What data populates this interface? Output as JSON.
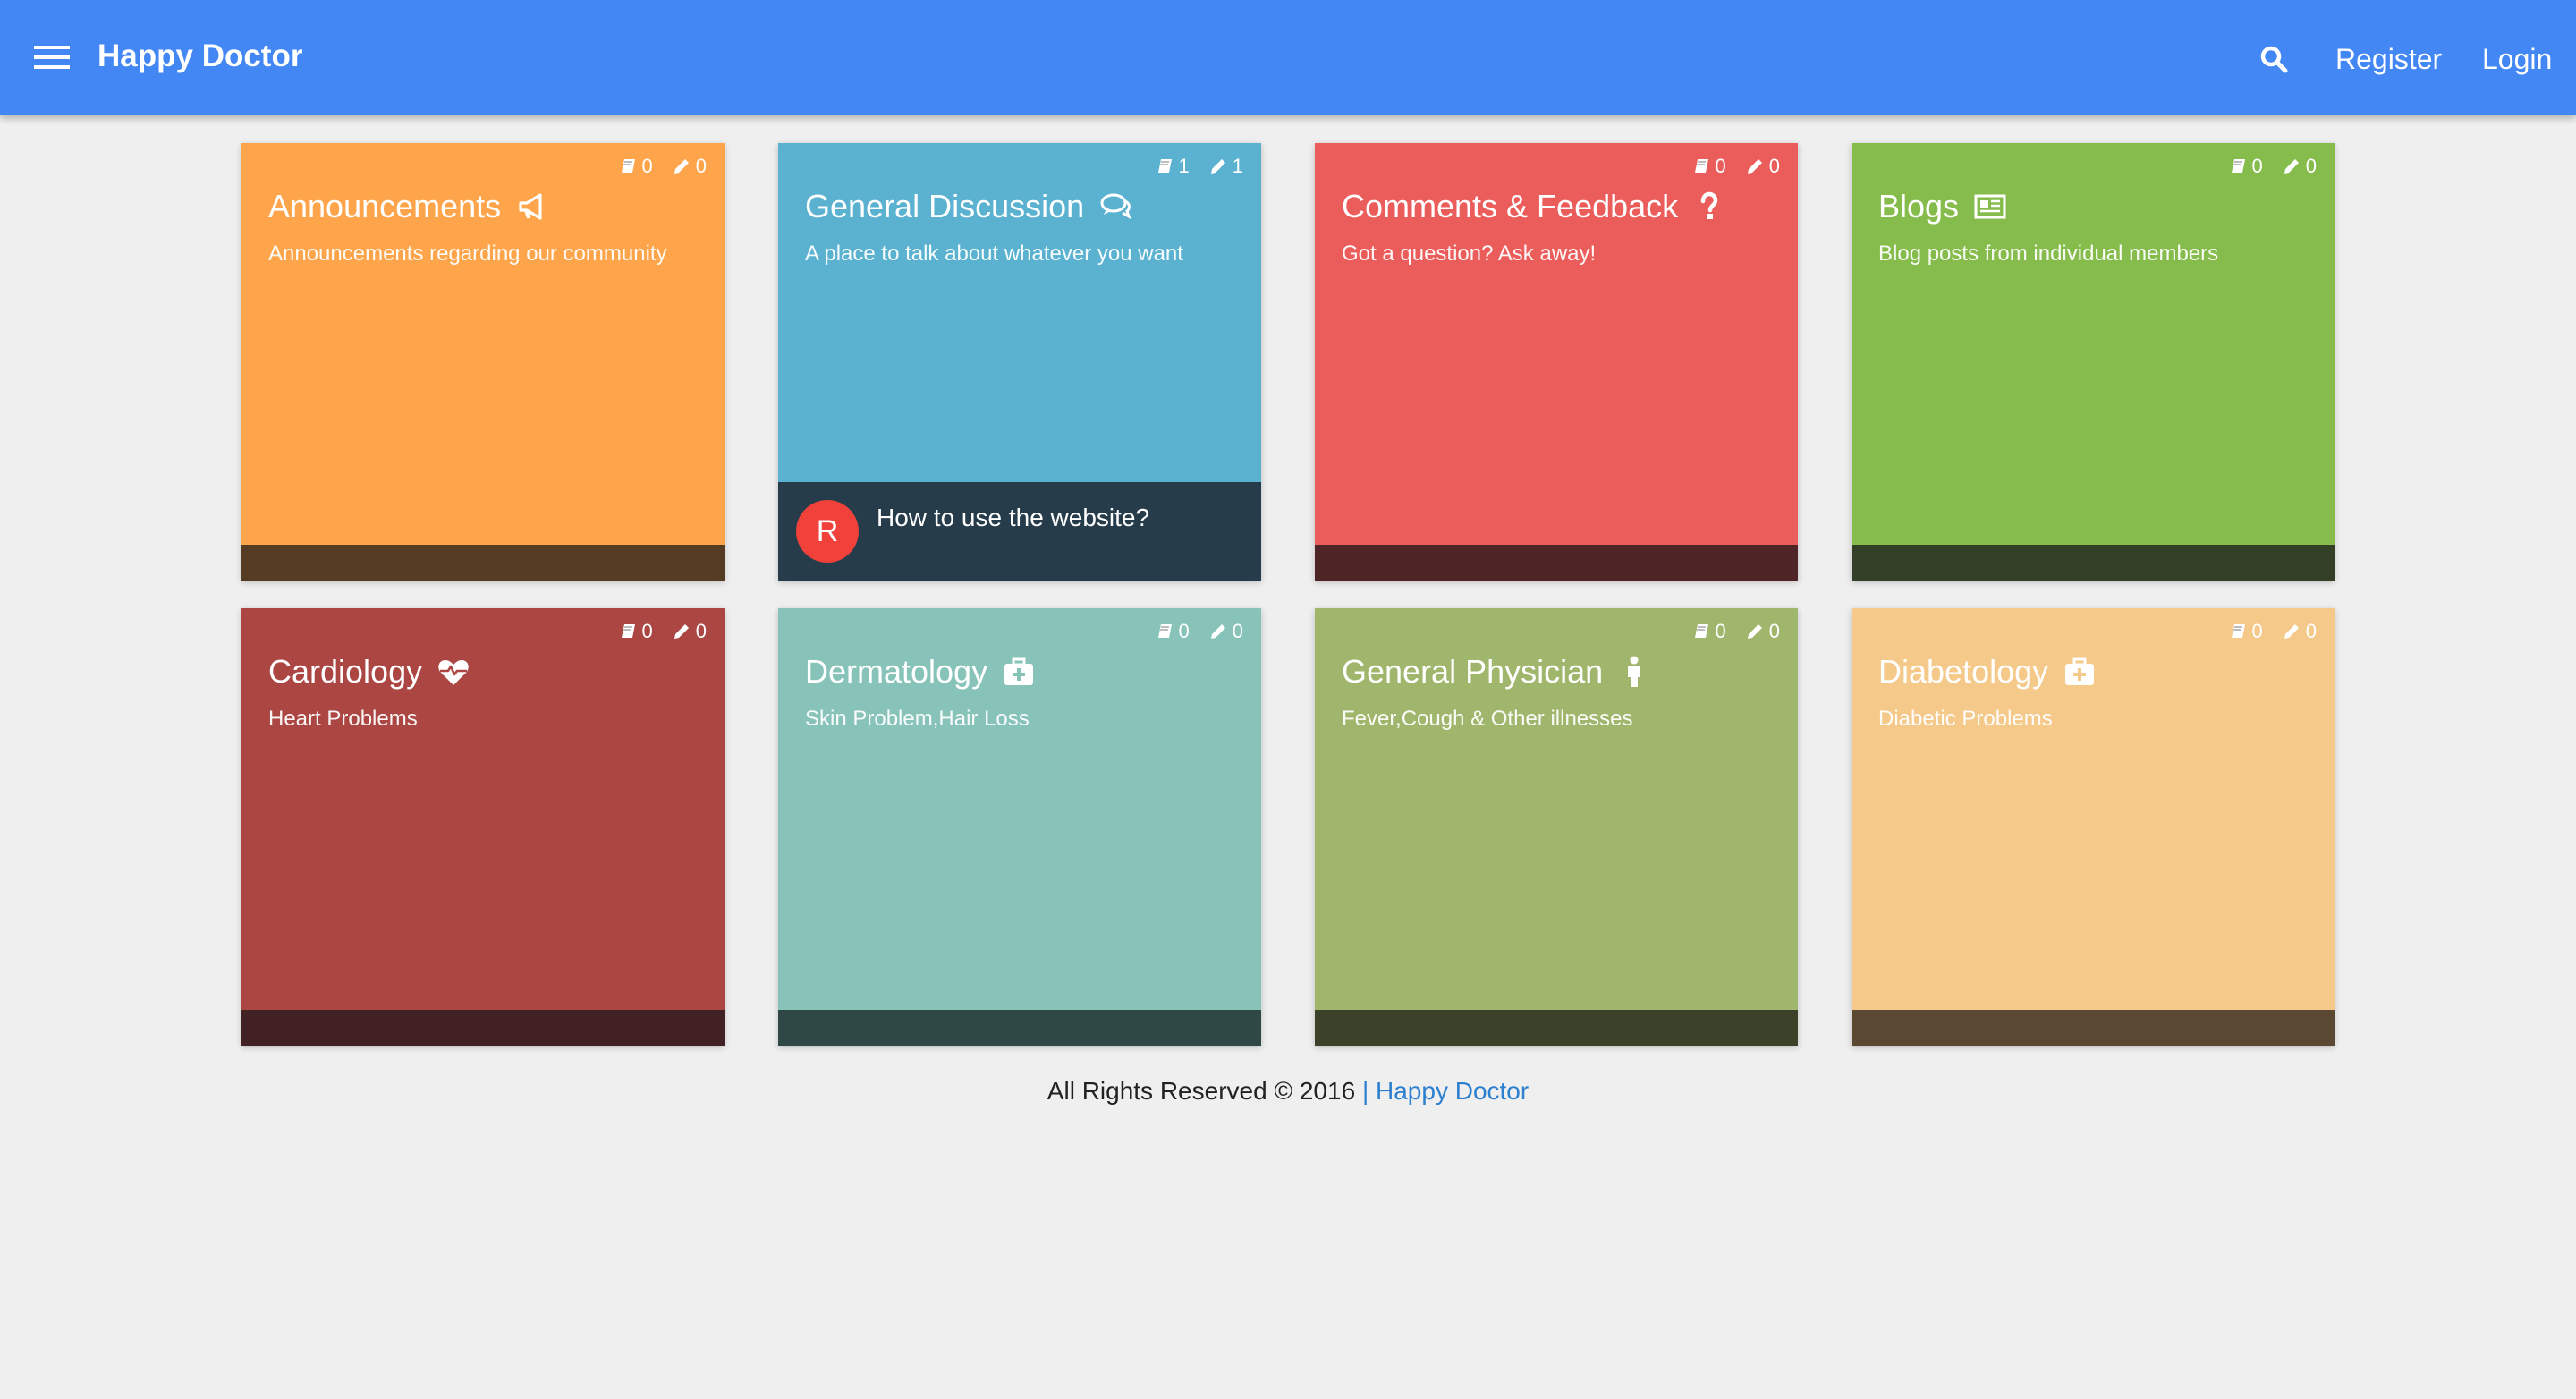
{
  "header": {
    "brand": "Happy Doctor",
    "nav": {
      "register": "Register",
      "login": "Login"
    },
    "color": "#4387f5"
  },
  "categories": [
    {
      "title": "Announcements",
      "description": "Announcements regarding our community",
      "topics": "0",
      "posts": "0",
      "icon": "bullhorn-icon",
      "color": "#fea54b",
      "footer_color": "#553c22"
    },
    {
      "title": "General Discussion",
      "description": "A place to talk about whatever you want",
      "topics": "1",
      "posts": "1",
      "icon": "comments-icon",
      "color": "#5ab2d0",
      "footer_color": "#263c4a",
      "latest": {
        "avatar_letter": "R",
        "title": "How to use the website?",
        "avatar_color": "#f0413b"
      }
    },
    {
      "title": "Comments & Feedback",
      "description": "Got a question? Ask away!",
      "topics": "0",
      "posts": "0",
      "icon": "question-icon",
      "color": "#eb5d5b",
      "footer_color": "#4f2427"
    },
    {
      "title": "Blogs",
      "description": "Blog posts from individual members",
      "topics": "0",
      "posts": "0",
      "icon": "newspaper-icon",
      "color": "#86bc4c",
      "footer_color": "#333f26"
    },
    {
      "title": "Cardiology",
      "description": "Heart Problems",
      "topics": "0",
      "posts": "0",
      "icon": "heartbeat-icon",
      "color": "#ab4643",
      "footer_color": "#412123"
    },
    {
      "title": "Dermatology",
      "description": "Skin Problem,Hair Loss",
      "topics": "0",
      "posts": "0",
      "icon": "medkit-icon",
      "color": "#87c3b9",
      "footer_color": "#304845"
    },
    {
      "title": "General Physician",
      "description": "Fever,Cough & Other illnesses",
      "topics": "0",
      "posts": "0",
      "icon": "male-icon",
      "color": "#a1b66d",
      "footer_color": "#3b4229"
    },
    {
      "title": "Diabetology",
      "description": "Diabetic Problems",
      "topics": "0",
      "posts": "0",
      "icon": "medkit-icon",
      "color": "#f5c98a",
      "footer_color": "#5a4832"
    }
  ],
  "footer": {
    "text": "All Rights Reserved © 2016",
    "separator": "|",
    "link": "Happy Doctor"
  }
}
